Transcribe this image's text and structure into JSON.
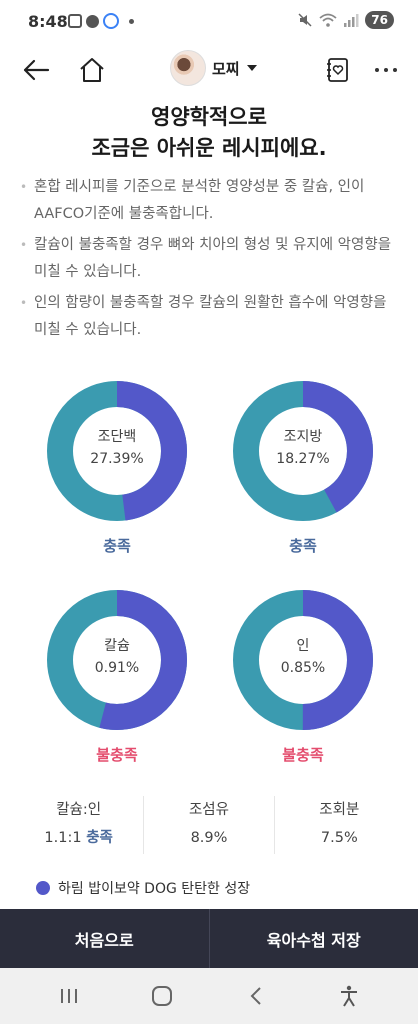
{
  "status_bar": {
    "time": "8:48",
    "battery": "76"
  },
  "header": {
    "profile_name": "모찌"
  },
  "title": {
    "line1": "영양학적으로",
    "line2": "조금은 아쉬운 레시피에요."
  },
  "notes": [
    "혼합 레시피를 기준으로 분석한 영양성분 중 칼슘, 인이 AAFCO기준에 불충족합니다.",
    "칼슘이 불충족할 경우 뼈와 치아의 형성 및 유지에 악영향을 미칠 수 있습니다.",
    "인의 함량이 불충족할 경우 칼슘의 원활한 흡수에 악영향을 미칠 수 있습니다."
  ],
  "donuts": [
    {
      "name": "조단백",
      "value": "27.39%",
      "status": "충족",
      "fill_fraction": 0.48
    },
    {
      "name": "조지방",
      "value": "18.27%",
      "status": "충족",
      "fill_fraction": 0.42
    },
    {
      "name": "칼슘",
      "value": "0.91%",
      "status": "불충족",
      "fill_fraction": 0.54
    },
    {
      "name": "인",
      "value": "0.85%",
      "status": "불충족",
      "fill_fraction": 0.5
    }
  ],
  "colors": {
    "fill": "#5358c9",
    "track": "#3b9bb0",
    "ok": "#4a6a9c",
    "bad": "#e44d6e"
  },
  "stats": {
    "ratio_label": "칼슘:인",
    "ratio_value": "1.1:1",
    "ratio_status": "충족",
    "fiber_label": "조섬유",
    "fiber_value": "8.9%",
    "ash_label": "조회분",
    "ash_value": "7.5%"
  },
  "legend": {
    "label": "하림 밥이보약 DOG 탄탄한 성장"
  },
  "bottom": {
    "first_label": "처음으로",
    "save_label": "육아수첩 저장"
  }
}
